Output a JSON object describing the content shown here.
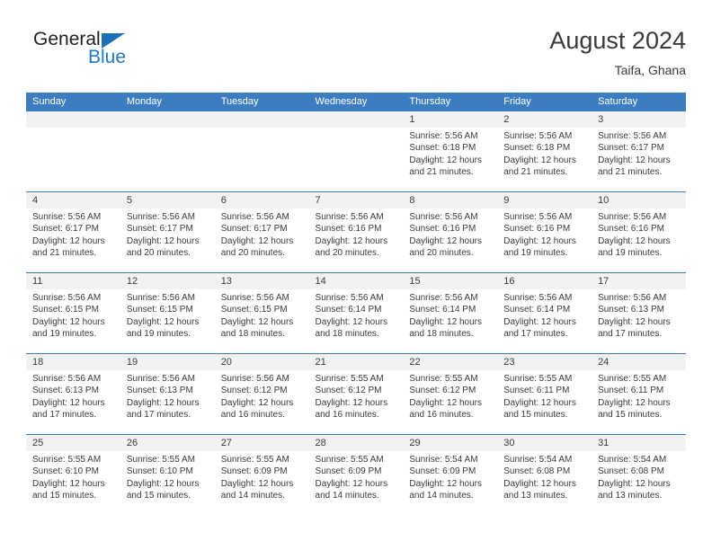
{
  "brand": {
    "word_one": "General",
    "word_two": "Blue",
    "triangle_icon": "blue-triangle-icon",
    "accent_color": "#1f7ac4"
  },
  "header": {
    "title": "August 2024",
    "subtitle": "Taifa, Ghana"
  },
  "calendar": {
    "header_color": "#3b7dc0",
    "daynum_band_color": "#f2f2f2",
    "weekday_headers": [
      "Sunday",
      "Monday",
      "Tuesday",
      "Wednesday",
      "Thursday",
      "Friday",
      "Saturday"
    ],
    "weeks": [
      [
        {
          "day": "",
          "lines": []
        },
        {
          "day": "",
          "lines": []
        },
        {
          "day": "",
          "lines": []
        },
        {
          "day": "",
          "lines": []
        },
        {
          "day": "1",
          "lines": [
            "Sunrise: 5:56 AM",
            "Sunset: 6:18 PM",
            "Daylight: 12 hours",
            "and 21 minutes."
          ]
        },
        {
          "day": "2",
          "lines": [
            "Sunrise: 5:56 AM",
            "Sunset: 6:18 PM",
            "Daylight: 12 hours",
            "and 21 minutes."
          ]
        },
        {
          "day": "3",
          "lines": [
            "Sunrise: 5:56 AM",
            "Sunset: 6:17 PM",
            "Daylight: 12 hours",
            "and 21 minutes."
          ]
        }
      ],
      [
        {
          "day": "4",
          "lines": [
            "Sunrise: 5:56 AM",
            "Sunset: 6:17 PM",
            "Daylight: 12 hours",
            "and 21 minutes."
          ]
        },
        {
          "day": "5",
          "lines": [
            "Sunrise: 5:56 AM",
            "Sunset: 6:17 PM",
            "Daylight: 12 hours",
            "and 20 minutes."
          ]
        },
        {
          "day": "6",
          "lines": [
            "Sunrise: 5:56 AM",
            "Sunset: 6:17 PM",
            "Daylight: 12 hours",
            "and 20 minutes."
          ]
        },
        {
          "day": "7",
          "lines": [
            "Sunrise: 5:56 AM",
            "Sunset: 6:16 PM",
            "Daylight: 12 hours",
            "and 20 minutes."
          ]
        },
        {
          "day": "8",
          "lines": [
            "Sunrise: 5:56 AM",
            "Sunset: 6:16 PM",
            "Daylight: 12 hours",
            "and 20 minutes."
          ]
        },
        {
          "day": "9",
          "lines": [
            "Sunrise: 5:56 AM",
            "Sunset: 6:16 PM",
            "Daylight: 12 hours",
            "and 19 minutes."
          ]
        },
        {
          "day": "10",
          "lines": [
            "Sunrise: 5:56 AM",
            "Sunset: 6:16 PM",
            "Daylight: 12 hours",
            "and 19 minutes."
          ]
        }
      ],
      [
        {
          "day": "11",
          "lines": [
            "Sunrise: 5:56 AM",
            "Sunset: 6:15 PM",
            "Daylight: 12 hours",
            "and 19 minutes."
          ]
        },
        {
          "day": "12",
          "lines": [
            "Sunrise: 5:56 AM",
            "Sunset: 6:15 PM",
            "Daylight: 12 hours",
            "and 19 minutes."
          ]
        },
        {
          "day": "13",
          "lines": [
            "Sunrise: 5:56 AM",
            "Sunset: 6:15 PM",
            "Daylight: 12 hours",
            "and 18 minutes."
          ]
        },
        {
          "day": "14",
          "lines": [
            "Sunrise: 5:56 AM",
            "Sunset: 6:14 PM",
            "Daylight: 12 hours",
            "and 18 minutes."
          ]
        },
        {
          "day": "15",
          "lines": [
            "Sunrise: 5:56 AM",
            "Sunset: 6:14 PM",
            "Daylight: 12 hours",
            "and 18 minutes."
          ]
        },
        {
          "day": "16",
          "lines": [
            "Sunrise: 5:56 AM",
            "Sunset: 6:14 PM",
            "Daylight: 12 hours",
            "and 17 minutes."
          ]
        },
        {
          "day": "17",
          "lines": [
            "Sunrise: 5:56 AM",
            "Sunset: 6:13 PM",
            "Daylight: 12 hours",
            "and 17 minutes."
          ]
        }
      ],
      [
        {
          "day": "18",
          "lines": [
            "Sunrise: 5:56 AM",
            "Sunset: 6:13 PM",
            "Daylight: 12 hours",
            "and 17 minutes."
          ]
        },
        {
          "day": "19",
          "lines": [
            "Sunrise: 5:56 AM",
            "Sunset: 6:13 PM",
            "Daylight: 12 hours",
            "and 17 minutes."
          ]
        },
        {
          "day": "20",
          "lines": [
            "Sunrise: 5:56 AM",
            "Sunset: 6:12 PM",
            "Daylight: 12 hours",
            "and 16 minutes."
          ]
        },
        {
          "day": "21",
          "lines": [
            "Sunrise: 5:55 AM",
            "Sunset: 6:12 PM",
            "Daylight: 12 hours",
            "and 16 minutes."
          ]
        },
        {
          "day": "22",
          "lines": [
            "Sunrise: 5:55 AM",
            "Sunset: 6:12 PM",
            "Daylight: 12 hours",
            "and 16 minutes."
          ]
        },
        {
          "day": "23",
          "lines": [
            "Sunrise: 5:55 AM",
            "Sunset: 6:11 PM",
            "Daylight: 12 hours",
            "and 15 minutes."
          ]
        },
        {
          "day": "24",
          "lines": [
            "Sunrise: 5:55 AM",
            "Sunset: 6:11 PM",
            "Daylight: 12 hours",
            "and 15 minutes."
          ]
        }
      ],
      [
        {
          "day": "25",
          "lines": [
            "Sunrise: 5:55 AM",
            "Sunset: 6:10 PM",
            "Daylight: 12 hours",
            "and 15 minutes."
          ]
        },
        {
          "day": "26",
          "lines": [
            "Sunrise: 5:55 AM",
            "Sunset: 6:10 PM",
            "Daylight: 12 hours",
            "and 15 minutes."
          ]
        },
        {
          "day": "27",
          "lines": [
            "Sunrise: 5:55 AM",
            "Sunset: 6:09 PM",
            "Daylight: 12 hours",
            "and 14 minutes."
          ]
        },
        {
          "day": "28",
          "lines": [
            "Sunrise: 5:55 AM",
            "Sunset: 6:09 PM",
            "Daylight: 12 hours",
            "and 14 minutes."
          ]
        },
        {
          "day": "29",
          "lines": [
            "Sunrise: 5:54 AM",
            "Sunset: 6:09 PM",
            "Daylight: 12 hours",
            "and 14 minutes."
          ]
        },
        {
          "day": "30",
          "lines": [
            "Sunrise: 5:54 AM",
            "Sunset: 6:08 PM",
            "Daylight: 12 hours",
            "and 13 minutes."
          ]
        },
        {
          "day": "31",
          "lines": [
            "Sunrise: 5:54 AM",
            "Sunset: 6:08 PM",
            "Daylight: 12 hours",
            "and 13 minutes."
          ]
        }
      ]
    ]
  }
}
